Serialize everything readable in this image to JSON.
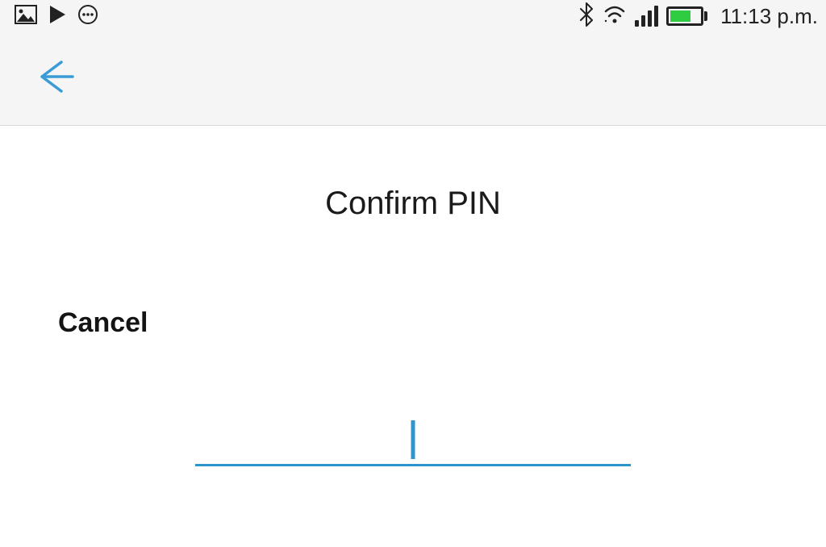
{
  "status": {
    "time": "11:13 p.m."
  },
  "nav": {
    "back": "back"
  },
  "page": {
    "title": "Confirm PIN",
    "cancel_label": "Cancel",
    "pin_value": ""
  }
}
